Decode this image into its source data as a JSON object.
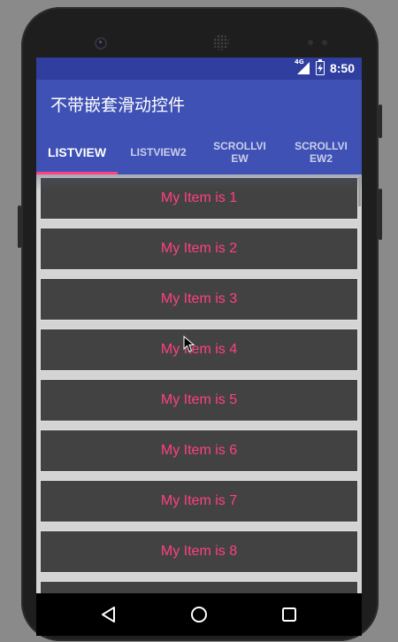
{
  "status_bar": {
    "network": "4G",
    "time": "8:50"
  },
  "app_bar": {
    "title": "不带嵌套滑动控件"
  },
  "tabs": [
    {
      "label": "LISTVIEW",
      "active": true
    },
    {
      "label": "LISTVIEW2",
      "active": false
    },
    {
      "label": "SCROLLVIEW",
      "active": false
    },
    {
      "label": "SCROLLVIEW2",
      "active": false
    }
  ],
  "list_items": [
    "My Item is 1",
    "My Item is 2",
    "My Item is 3",
    "My Item is 4",
    "My Item is 5",
    "My Item is 6",
    "My Item is 7",
    "My Item is 8"
  ],
  "nav_bar": {
    "back": "back-icon",
    "home": "home-icon",
    "recents": "recents-icon"
  },
  "colors": {
    "primary": "#3f51b5",
    "primary_dark": "#303f9f",
    "accent": "#ff4081",
    "item_bg": "#424242"
  }
}
